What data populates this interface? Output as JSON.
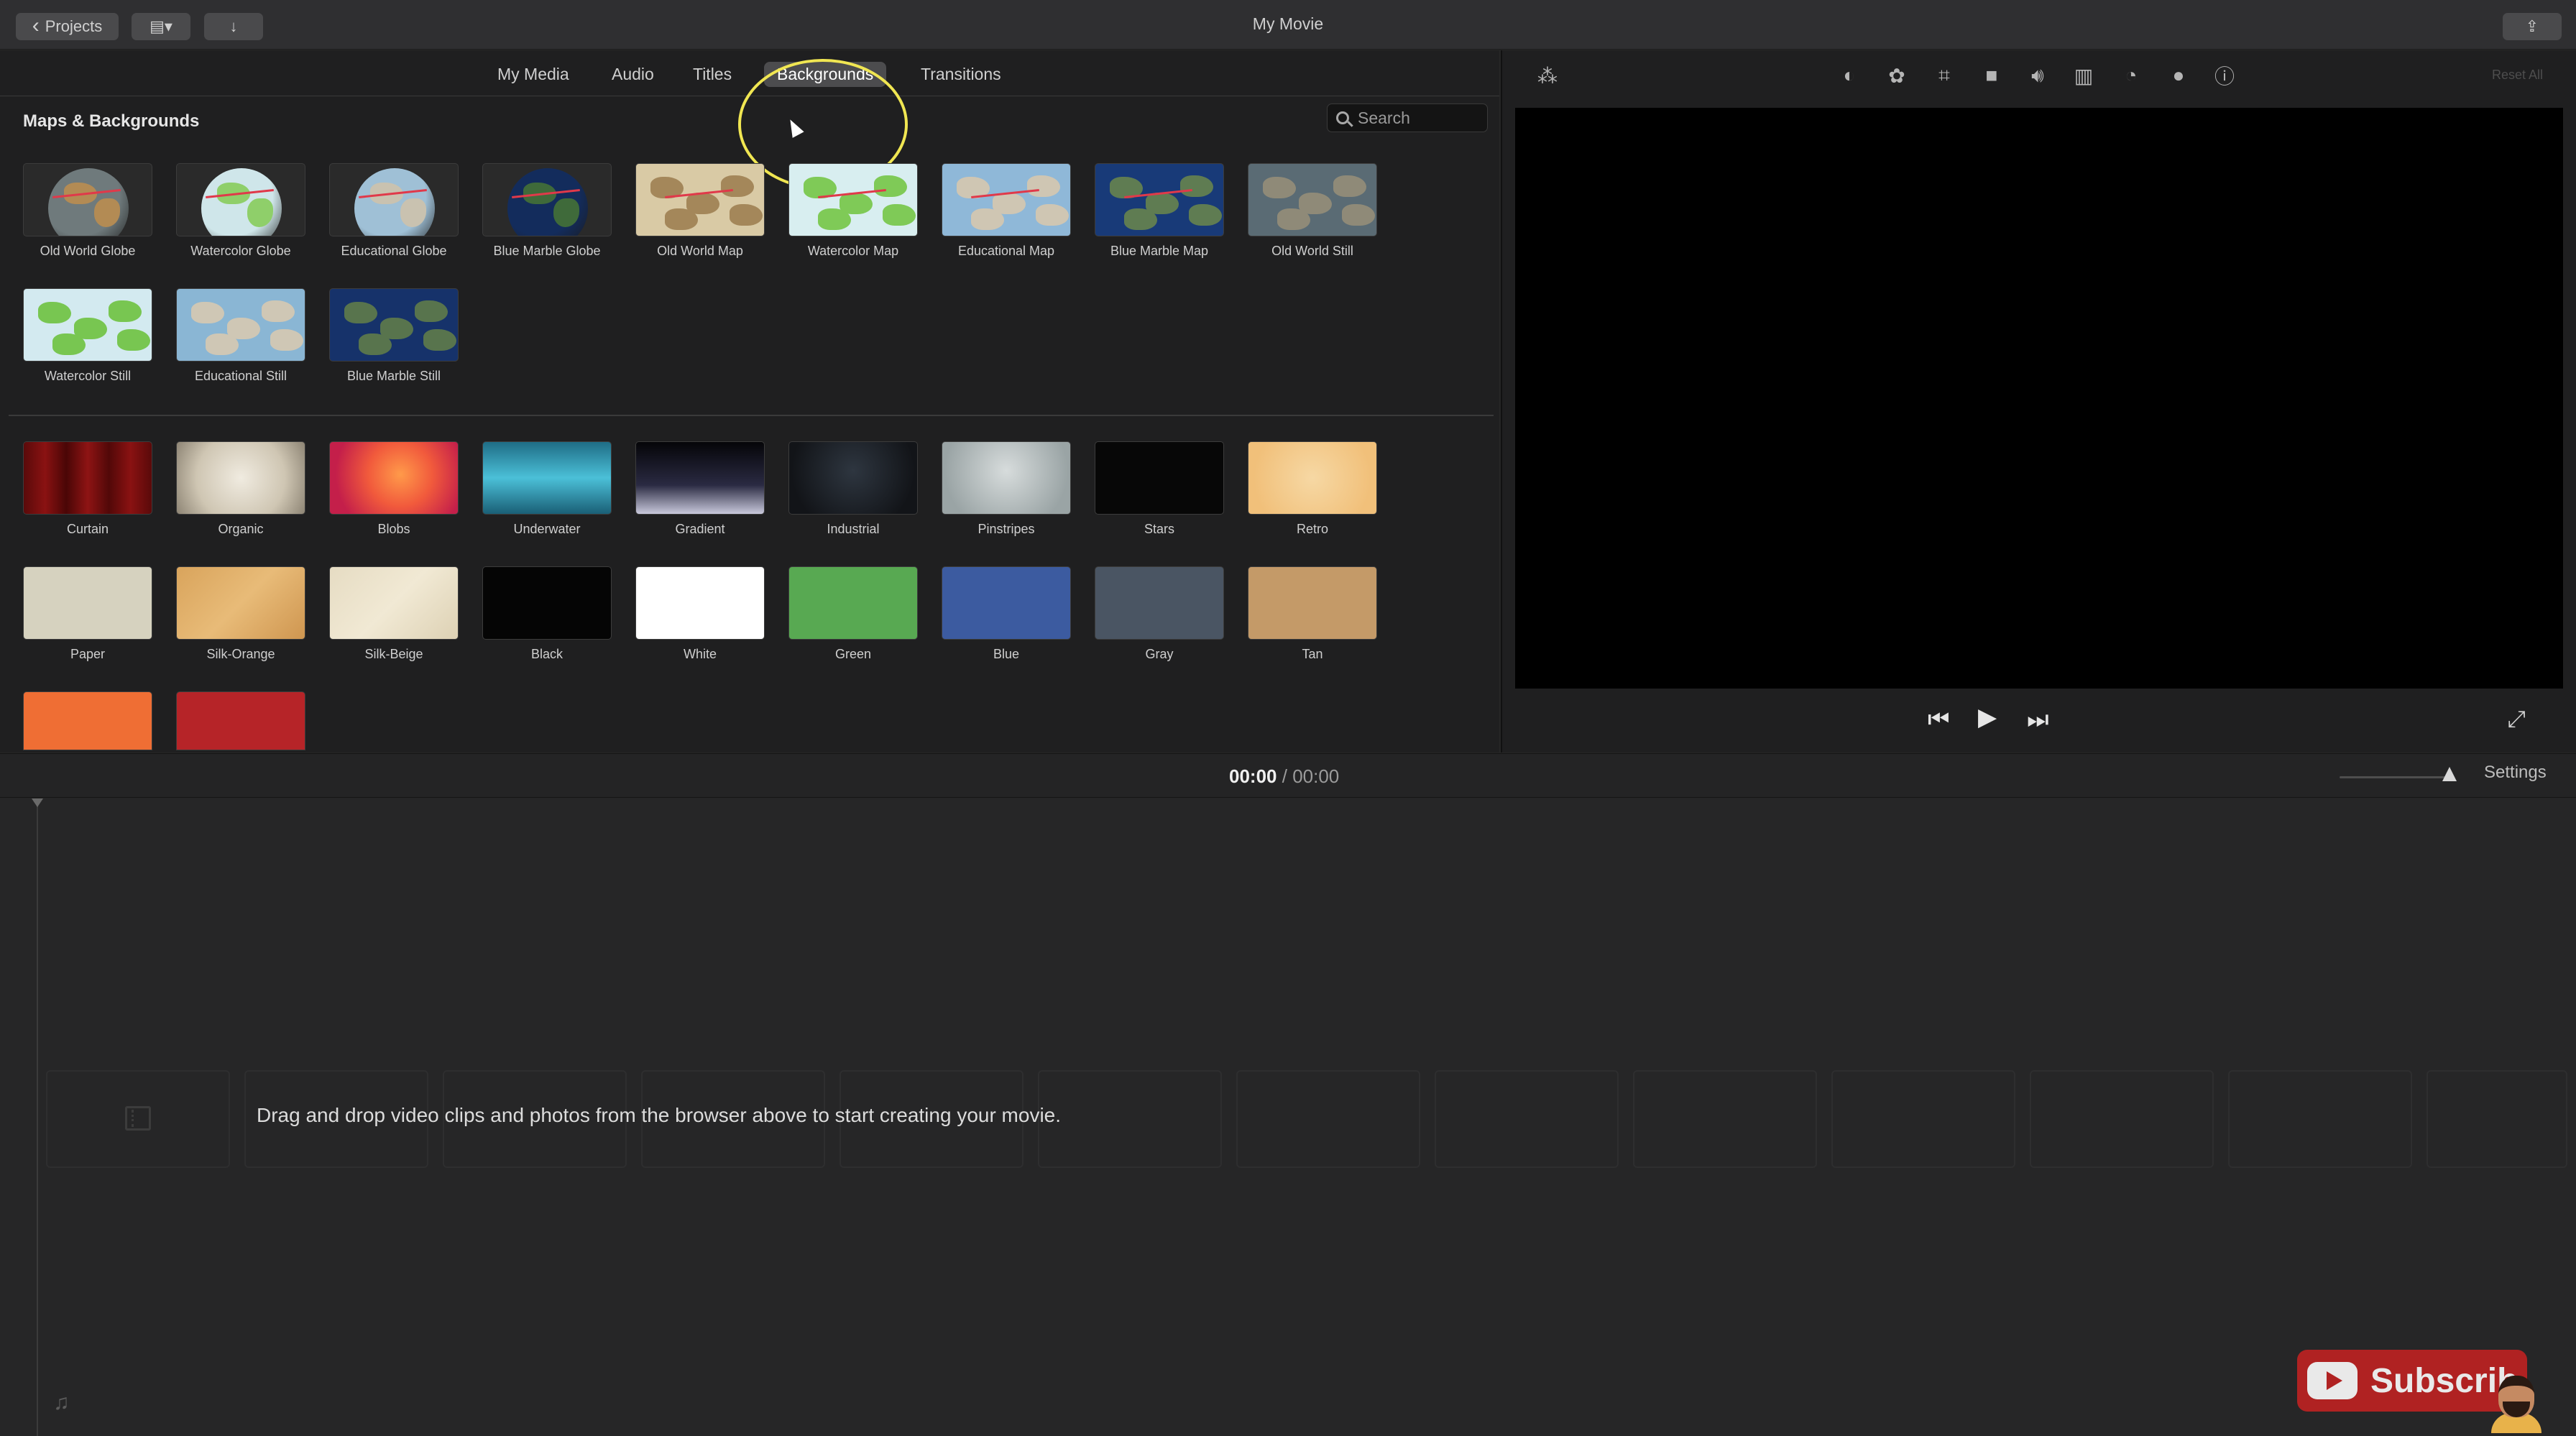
{
  "window": {
    "title": "My Movie",
    "projects_label": "Projects"
  },
  "browser": {
    "tabs": [
      {
        "label": "My Media"
      },
      {
        "label": "Audio"
      },
      {
        "label": "Titles"
      },
      {
        "label": "Backgrounds",
        "active": true
      },
      {
        "label": "Transitions"
      }
    ],
    "section_title": "Maps & Backgrounds",
    "search_placeholder": "Search",
    "maps": [
      {
        "label": "Old World Globe",
        "style": "globe",
        "land": "#b38b54",
        "sea": "#6f7a7c"
      },
      {
        "label": "Watercolor Globe",
        "style": "globe",
        "land": "#8fcf6a",
        "sea": "#cfe6ea"
      },
      {
        "label": "Educational Globe",
        "style": "globe",
        "land": "#c9c2b0",
        "sea": "#9fc0d6"
      },
      {
        "label": "Blue Marble Globe",
        "style": "globe",
        "land": "#3f6a3a",
        "sea": "#132c5c"
      },
      {
        "label": "Old World Map",
        "style": "map",
        "land": "#a4875a",
        "sea": "#d9caa5"
      },
      {
        "label": "Watercolor Map",
        "style": "map",
        "land": "#7fca57",
        "sea": "#d8eef0"
      },
      {
        "label": "Educational Map",
        "style": "map",
        "land": "#cfc6b3",
        "sea": "#8fb8d8"
      },
      {
        "label": "Blue Marble Map",
        "style": "map",
        "land": "#5f7c52",
        "sea": "#183a78"
      },
      {
        "label": "Old World Still",
        "style": "map",
        "land": "#8f8a78",
        "sea": "#5a6b74"
      },
      {
        "label": "Watercolor Still",
        "style": "map",
        "land": "#78c651",
        "sea": "#d3eaf0"
      },
      {
        "label": "Educational Still",
        "style": "map",
        "land": "#cfc7b5",
        "sea": "#8ab6d4"
      },
      {
        "label": "Blue Marble Still",
        "style": "map",
        "land": "#58744d",
        "sea": "#16326a"
      }
    ],
    "backgrounds": [
      {
        "label": "Curtain",
        "fill": "linear-gradient(90deg,#5a0a0a,#8a1212,#4a0606,#8e1414,#520808,#8a1212,#5a0a0a)"
      },
      {
        "label": "Organic",
        "fill": "radial-gradient(circle at 50% 50%,#f0ebe0,#cfc6b3 60%,#8d8474)"
      },
      {
        "label": "Blobs",
        "fill": "radial-gradient(circle at 55% 45%,#ff9a4a,#f15a3c 40%,#c41f4a 80%)"
      },
      {
        "label": "Underwater",
        "fill": "linear-gradient(180deg,#1f6d86,#4bc0d8 50%,#1a5f76)"
      },
      {
        "label": "Gradient",
        "fill": "linear-gradient(180deg,#050508,#2a2a42 60%,#c9c9dc)"
      },
      {
        "label": "Industrial",
        "fill": "radial-gradient(circle at 50% 40%,#2e3640,#121418 80%)"
      },
      {
        "label": "Pinstripes",
        "fill": "radial-gradient(circle at 50% 40%,#d7dcdc,#9aa4a5 80%)"
      },
      {
        "label": "Stars",
        "fill": "#070707"
      },
      {
        "label": "Retro",
        "fill": "radial-gradient(circle at 50% 50%,#f6d8a4,#f1c07a 80%)"
      },
      {
        "label": "Paper",
        "fill": "#d6d2bf"
      },
      {
        "label": "Silk-Orange",
        "fill": "linear-gradient(135deg,#d9a45c,#e8bb78 50%,#cf9650)"
      },
      {
        "label": "Silk-Beige",
        "fill": "linear-gradient(135deg,#e6dcc3,#f1e9d4 50%,#ddd1b4)"
      },
      {
        "label": "Black",
        "fill": "#050505"
      },
      {
        "label": "White",
        "fill": "#ffffff"
      },
      {
        "label": "Green",
        "fill": "#58a952"
      },
      {
        "label": "Blue",
        "fill": "#3c5ba0"
      },
      {
        "label": "Gray",
        "fill": "#4a5563"
      },
      {
        "label": "Tan",
        "fill": "#c49a68"
      },
      {
        "label": "",
        "fill": "#ef6e34"
      },
      {
        "label": "",
        "fill": "#b62428"
      }
    ]
  },
  "viewer": {
    "reset_label": "Reset All",
    "tool_icons": [
      "magic-wand-icon",
      "color-balance-icon",
      "color-correction-icon",
      "crop-icon",
      "stabilization-icon",
      "volume-icon",
      "noise-reduction-icon",
      "speed-icon",
      "clip-filter-icon",
      "info-icon"
    ]
  },
  "timeline": {
    "current_time": "00:00",
    "separator": "/",
    "duration": "00:00",
    "settings_label": "Settings",
    "drop_hint": "Drag and drop video clips and photos from the browser above to start creating your movie."
  },
  "overlay": {
    "subscribe_label": "Subscrib",
    "accent": "#b02222"
  }
}
